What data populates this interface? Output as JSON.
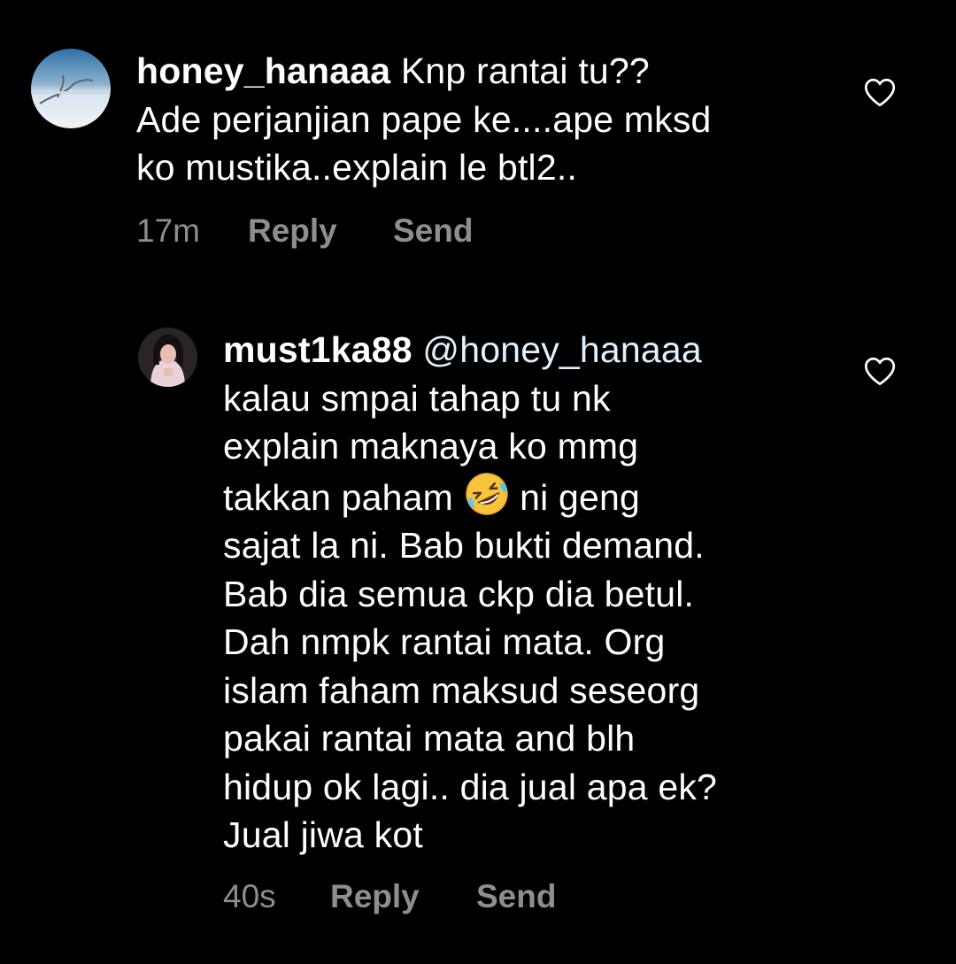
{
  "comments": [
    {
      "username": "honey_hanaaa",
      "text_line1": " Knp rantai tu??",
      "text_rest": "Ade perjanjian pape ke....ape mksd\nko mustika..explain le btl2..",
      "time": "17m",
      "reply_label": "Reply",
      "send_label": "Send"
    },
    {
      "username": "must1ka88",
      "mention": "@honey_hanaaa",
      "text_before_emoji": "kalau smpai tahap tu nk\nexplain maknaya ko mmg\ntakkan paham ",
      "emoji_icon": "rolling-on-floor-laughing-icon",
      "text_after_emoji": " ni geng\nsajat la ni. Bab bukti demand.\nBab dia semua ckp dia betul.\nDah  nmpk rantai mata. Org\nislam faham maksud seseorg\npakai rantai mata and blh\nhidup ok lagi.. dia jual apa ek?\nJual jiwa kot",
      "time": "40s",
      "reply_label": "Reply",
      "send_label": "Send"
    }
  ],
  "icons": {
    "like": "heart-outline-icon"
  },
  "colors": {
    "background": "#000000",
    "text": "#ffffff",
    "meta_text": "#8e8e8e",
    "mention": "#e0f1ff"
  }
}
